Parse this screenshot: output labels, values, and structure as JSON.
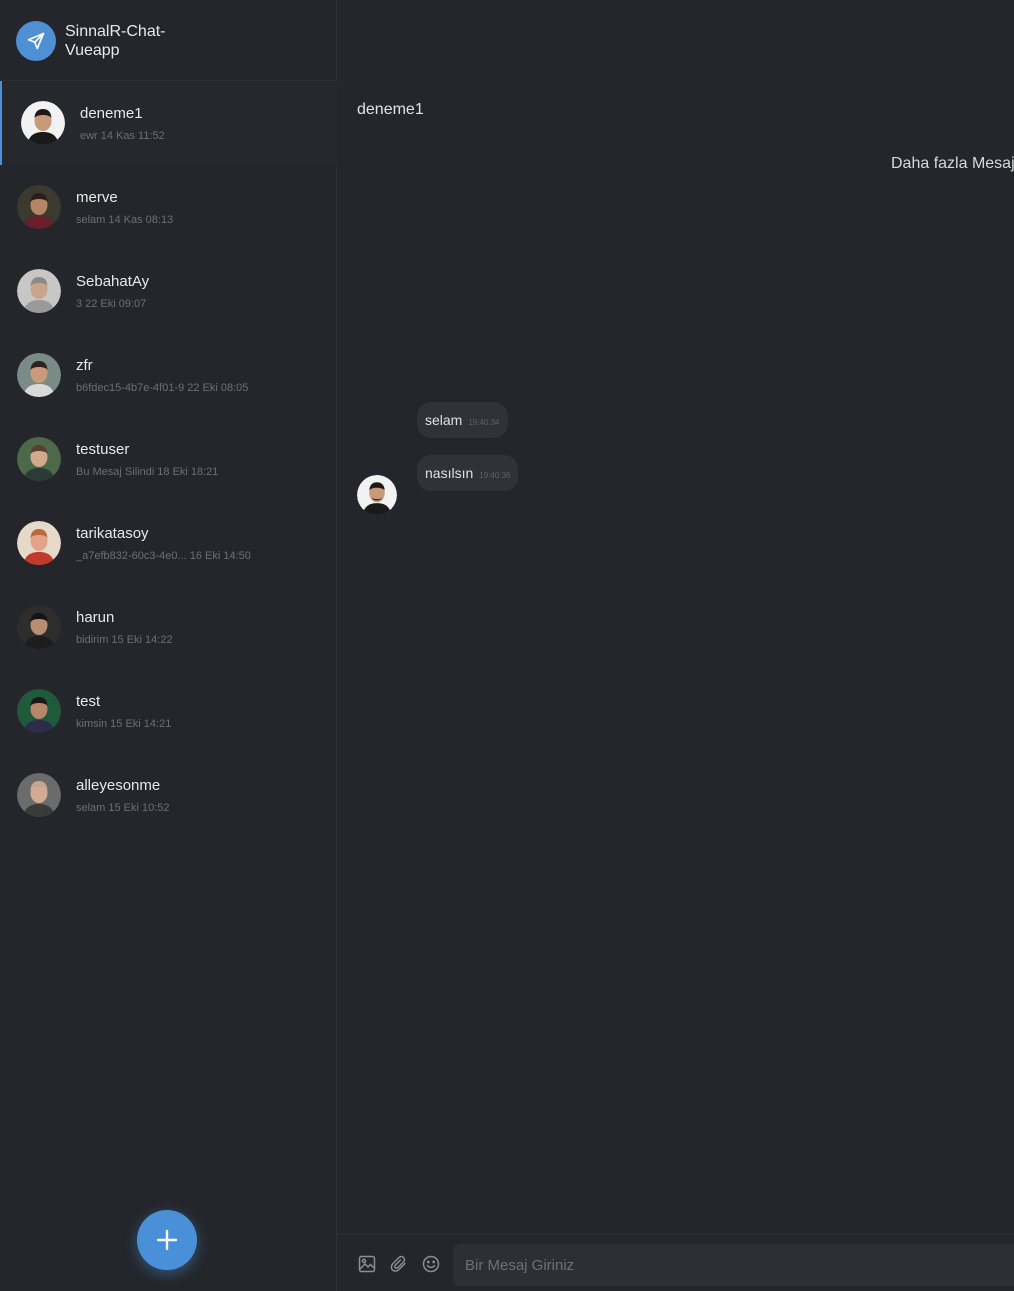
{
  "app": {
    "title": "SinnalR-Chat-Vueapp"
  },
  "contacts": [
    {
      "name": "deneme1",
      "last_message": "ewr",
      "time": "14 Kas 11:52",
      "active": true,
      "skin": "#c89a7a",
      "hair": "#1f1a17",
      "shirt": "#1a1a1a",
      "bg": "#f2f2f2"
    },
    {
      "name": "merve",
      "last_message": "selam",
      "time": "14 Kas 08:13",
      "active": false,
      "skin": "#b48664",
      "hair": "#2a1e1a",
      "shirt": "#6b1d2a",
      "bg": "#3b3a2f"
    },
    {
      "name": "SebahatAy",
      "last_message": "3",
      "time": "22 Eki 09:07",
      "active": false,
      "skin": "#c9a58a",
      "hair": "#8a8a8a",
      "shirt": "#9a9a9a",
      "bg": "#c7c7c7"
    },
    {
      "name": "zfr",
      "last_message": "b6fdec15-4b7e-4f01-9",
      "time": "22 Eki 08:05",
      "active": false,
      "skin": "#c99b7c",
      "hair": "#2a2320",
      "shirt": "#d9d9d9",
      "bg": "#7a8a86"
    },
    {
      "name": "testuser",
      "last_message": "Bu Mesaj Silindi",
      "time": "18 Eki 18:21",
      "active": false,
      "skin": "#d2a98d",
      "hair": "#5a3f2c",
      "shirt": "#2e3b35",
      "bg": "#4c6a4a"
    },
    {
      "name": "tarikatasoy",
      "last_message": "_a7efb832-60c3-4e0...",
      "time": "16 Eki 14:50",
      "active": false,
      "skin": "#e3a38a",
      "hair": "#b86b3d",
      "shirt": "#c23a2b",
      "bg": "#e7d9c9"
    },
    {
      "name": "harun",
      "last_message": "bidirim",
      "time": "15 Eki 14:22",
      "active": false,
      "skin": "#b88e71",
      "hair": "#141414",
      "shirt": "#1d1d1d",
      "bg": "#2d2d2d"
    },
    {
      "name": "test",
      "last_message": "kimsin",
      "time": "15 Eki 14:21",
      "active": false,
      "skin": "#b8876a",
      "hair": "#1a1a1a",
      "shirt": "#2c2c4a",
      "bg": "#1f5a3a"
    },
    {
      "name": "alleyesonme",
      "last_message": "selam",
      "time": "15 Eki 10:52",
      "active": false,
      "skin": "#d1ac93",
      "hair": "#c7a58f",
      "shirt": "#3a3a3a",
      "bg": "#6b6b6b"
    }
  ],
  "chat": {
    "title": "deneme1",
    "more_messages": "Daha fazla Mesaj",
    "messages": [
      {
        "text": "selam",
        "time": "19:40:34"
      },
      {
        "text": "nasılsın",
        "time": "19:40:36"
      }
    ],
    "input_placeholder": "Bir Mesaj Giriniz"
  },
  "icons": {
    "logo": "send-icon",
    "fab": "plus-icon",
    "tools": [
      "image-icon",
      "paperclip-icon",
      "smiley-icon"
    ]
  },
  "colors": {
    "accent": "#4a90d9",
    "background": "#24262b",
    "bubble": "#2f3237"
  }
}
